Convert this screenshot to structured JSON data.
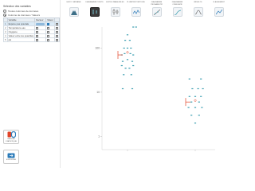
{
  "left": {
    "title": "Sélection des variables",
    "radios": [
      {
        "label": "Toutes colonnes de données",
        "selected": false
      },
      {
        "label": "Colonne de données / Valeurs",
        "selected": true
      }
    ],
    "table": {
      "headers": [
        "",
        "Variable",
        "Facteur",
        "Valeur",
        ""
      ],
      "rows": [
        {
          "num": "1",
          "name": "Espèce pas spéciale",
          "selected": true
        },
        {
          "num": "2",
          "name": "Température eau",
          "selected": false
        },
        {
          "num": "3",
          "name": "Oxygène",
          "selected": false
        },
        {
          "num": "4",
          "name": "Valeur entre les quantités",
          "selected": false
        },
        {
          "num": "5",
          "name": "pH",
          "selected": false
        }
      ]
    },
    "buttons": [
      {
        "label": "TABLEAU STATISTIQUE",
        "icon": "stats-table-icon"
      },
      {
        "label": "EXPORTER",
        "icon": "export-icon"
      }
    ]
  },
  "toolbar": {
    "tools": [
      {
        "label": "HISTO. MÉDIANE",
        "icon": "histogram-icon",
        "active": false
      },
      {
        "label": "DIAGRAMME POINTS",
        "icon": "dot-plot-icon",
        "active": true
      },
      {
        "label": "BOITES PARALLÈLES",
        "icon": "boxplot-icon",
        "active": false
      },
      {
        "label": "PLURIPROPORTIONS",
        "icon": "line-chart-icon",
        "active": false
      },
      {
        "label": "DIAGRAMME PROBABILITÉ",
        "icon": "probability-icon",
        "active": false
      },
      {
        "label": "DIAGRAMME CUMULATIF",
        "icon": "cumulative-icon",
        "active": false
      },
      {
        "label": "RÉSULTS",
        "icon": "results-icon",
        "active": false
      },
      {
        "label": "CLASSEMENT",
        "icon": "ranking-icon",
        "active": false
      }
    ]
  },
  "colors": {
    "point": "#3c9fb1",
    "median": "#e2452a",
    "mean_marker": "#e2452a",
    "active_tool": "#3a3a3a"
  },
  "chart_data": {
    "type": "scatter",
    "scale": "log",
    "ylim": [
      0.5,
      300
    ],
    "y_ticks": [
      {
        "value": 1,
        "label": "1"
      },
      {
        "value": 10,
        "label": "10"
      },
      {
        "value": 100,
        "label": "100"
      }
    ],
    "categories": [
      "",
      ""
    ],
    "groups": [
      {
        "median": 70,
        "mean": 80,
        "points": [
          [
            0,
            200
          ],
          [
            -0.12,
            150
          ],
          [
            0.12,
            150
          ],
          [
            -0.18,
            100
          ],
          [
            0,
            100
          ],
          [
            0.18,
            100
          ],
          [
            -0.3,
            70
          ],
          [
            -0.15,
            75
          ],
          [
            0.15,
            75
          ],
          [
            0.3,
            70
          ],
          [
            -0.25,
            50
          ],
          [
            0,
            55
          ],
          [
            0.25,
            50
          ],
          [
            -0.3,
            40
          ],
          [
            -0.1,
            35
          ],
          [
            0.1,
            35
          ],
          [
            0.3,
            40
          ],
          [
            -0.2,
            25
          ],
          [
            0.2,
            25
          ],
          [
            -0.25,
            12
          ],
          [
            0.25,
            12
          ],
          [
            0.3,
            300
          ],
          [
            0.45,
            300
          ]
        ]
      },
      {
        "median": 6,
        "mean": 6.5,
        "points": [
          [
            -0.3,
            20
          ],
          [
            0.3,
            20
          ],
          [
            -0.15,
            12
          ],
          [
            0.15,
            12
          ],
          [
            0.4,
            12
          ],
          [
            -0.3,
            8
          ],
          [
            0,
            8
          ],
          [
            0.3,
            8
          ],
          [
            -0.2,
            6
          ],
          [
            0.2,
            6
          ],
          [
            -0.35,
            4.5
          ],
          [
            0,
            4.5
          ],
          [
            0.35,
            4.5
          ],
          [
            -0.2,
            3
          ],
          [
            0.2,
            3
          ],
          [
            0,
            2
          ]
        ]
      }
    ]
  }
}
